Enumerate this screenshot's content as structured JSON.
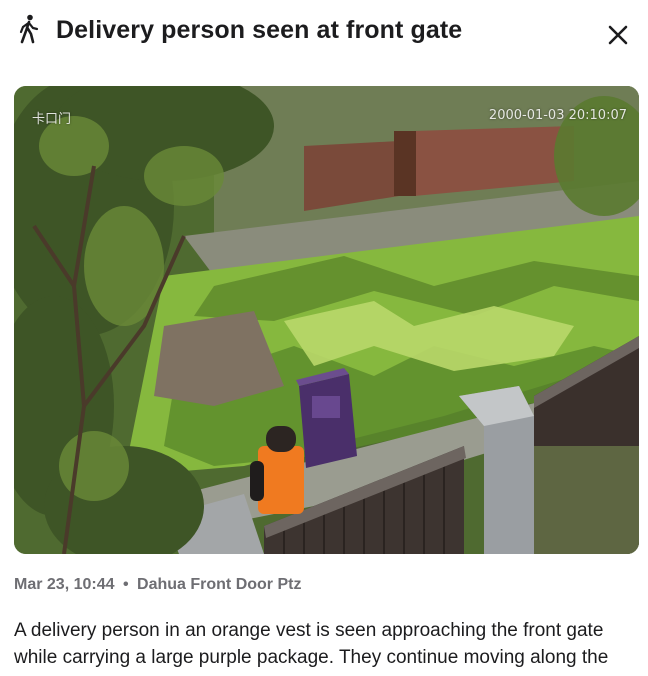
{
  "header": {
    "title": "Delivery person seen at front gate",
    "icon": "person-walking-icon",
    "close_icon": "close-icon"
  },
  "snapshot": {
    "osd_left": "卡口门",
    "osd_timestamp": "2000-01-03 20:10:07"
  },
  "meta": {
    "time": "Mar 23, 10:44",
    "separator": "•",
    "camera": "Dahua Front Door Ptz"
  },
  "description": "A delivery person in an orange vest is seen approaching the front gate while carrying a large purple package. They continue moving along the"
}
